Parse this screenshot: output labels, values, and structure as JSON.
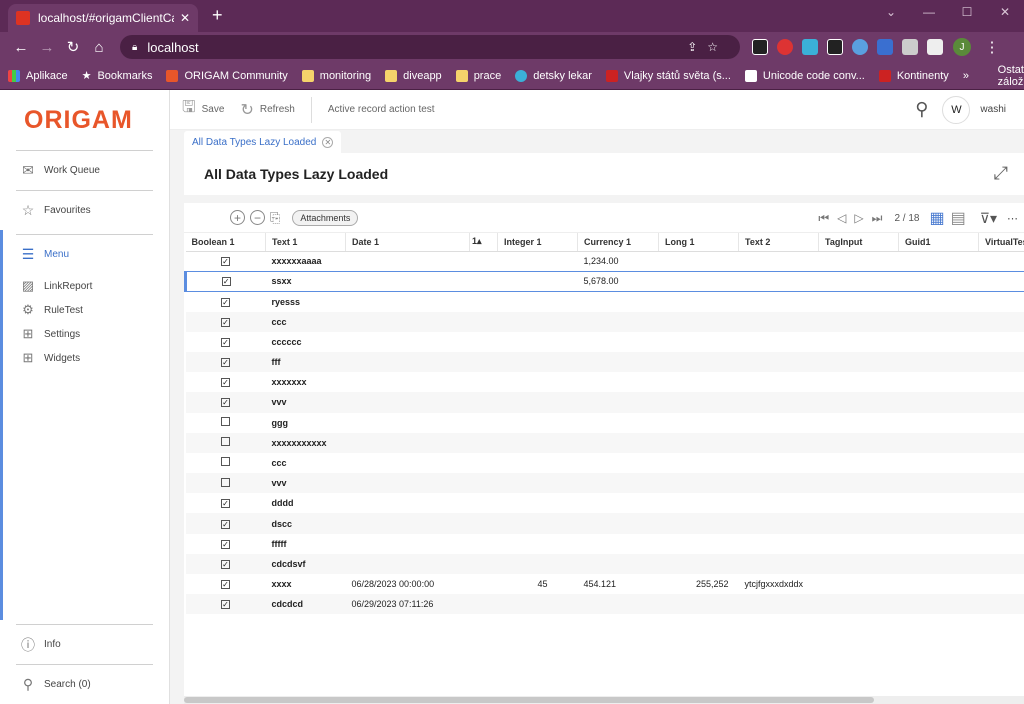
{
  "browser": {
    "tab_title": "localhost/#origamClientCallback/",
    "url": "localhost",
    "profile_initial": "J",
    "bookmarks": [
      "Aplikace",
      "Bookmarks",
      "ORIGAM Community",
      "monitoring",
      "diveapp",
      "prace",
      "detsky lekar",
      "Vlajky států světa (s...",
      "Unicode code conv...",
      "Kontinenty"
    ],
    "other_bookmarks": "Ostatní záložky"
  },
  "app": {
    "logo": "ORIGAM",
    "toolbar": {
      "save": "Save",
      "refresh": "Refresh",
      "action": "Active record action test"
    },
    "user": {
      "initial": "W",
      "name": "washi"
    },
    "sidebar": {
      "work_queue": "Work Queue",
      "favourites": "Favourites",
      "menu": "Menu",
      "items": [
        "LinkReport",
        "RuleTest",
        "Settings",
        "Widgets"
      ],
      "info": "Info",
      "search": "Search (0)"
    },
    "tab_label": "All Data Types Lazy Loaded",
    "form_title": "All Data Types Lazy Loaded",
    "grid": {
      "attachments": "Attachments",
      "page": "2 / 18",
      "sort_marker": "1▴",
      "columns": [
        "Boolean 1",
        "Text 1",
        "Date 1",
        "Integer 1",
        "Currency 1",
        "Long 1",
        "Text 2",
        "TagInput",
        "Guid1",
        "VirtualTes"
      ],
      "rows": [
        {
          "b": true,
          "text1": "xxxxxxaaaa",
          "date": "",
          "int": "",
          "cur": "1,234.00",
          "long": "",
          "text2": ""
        },
        {
          "b": true,
          "text1": "ssxx",
          "date": "",
          "int": "",
          "cur": "5,678.00",
          "long": "",
          "text2": ""
        },
        {
          "b": true,
          "text1": "ryesss",
          "date": "",
          "int": "",
          "cur": "",
          "long": "",
          "text2": ""
        },
        {
          "b": true,
          "text1": "ccc",
          "date": "",
          "int": "",
          "cur": "",
          "long": "",
          "text2": ""
        },
        {
          "b": true,
          "text1": "cccccc",
          "date": "",
          "int": "",
          "cur": "",
          "long": "",
          "text2": ""
        },
        {
          "b": true,
          "text1": "fff",
          "date": "",
          "int": "",
          "cur": "",
          "long": "",
          "text2": ""
        },
        {
          "b": true,
          "text1": "xxxxxxx",
          "date": "",
          "int": "",
          "cur": "",
          "long": "",
          "text2": ""
        },
        {
          "b": true,
          "text1": "vvv",
          "date": "",
          "int": "",
          "cur": "",
          "long": "",
          "text2": ""
        },
        {
          "b": false,
          "text1": "ggg",
          "date": "",
          "int": "",
          "cur": "",
          "long": "",
          "text2": ""
        },
        {
          "b": false,
          "text1": "xxxxxxxxxxx",
          "date": "",
          "int": "",
          "cur": "",
          "long": "",
          "text2": ""
        },
        {
          "b": false,
          "text1": "ccc",
          "date": "",
          "int": "",
          "cur": "",
          "long": "",
          "text2": ""
        },
        {
          "b": false,
          "text1": "vvv",
          "date": "",
          "int": "",
          "cur": "",
          "long": "",
          "text2": ""
        },
        {
          "b": true,
          "text1": "dddd",
          "date": "",
          "int": "",
          "cur": "",
          "long": "",
          "text2": ""
        },
        {
          "b": true,
          "text1": "dscc",
          "date": "",
          "int": "",
          "cur": "",
          "long": "",
          "text2": ""
        },
        {
          "b": true,
          "text1": "fffff",
          "date": "",
          "int": "",
          "cur": "",
          "long": "",
          "text2": ""
        },
        {
          "b": true,
          "text1": "cdcdsvf",
          "date": "",
          "int": "",
          "cur": "",
          "long": "",
          "text2": ""
        },
        {
          "b": true,
          "text1": "xxxx",
          "date": "06/28/2023 00:00:00",
          "int": "45",
          "cur": "454.121",
          "long": "255,252",
          "text2": "ytcjfgxxxdxddx"
        },
        {
          "b": true,
          "text1": "cdcdcd",
          "date": "06/29/2023 07:11:26",
          "int": "",
          "cur": "",
          "long": "",
          "text2": ""
        }
      ],
      "selected_row": 1
    }
  }
}
